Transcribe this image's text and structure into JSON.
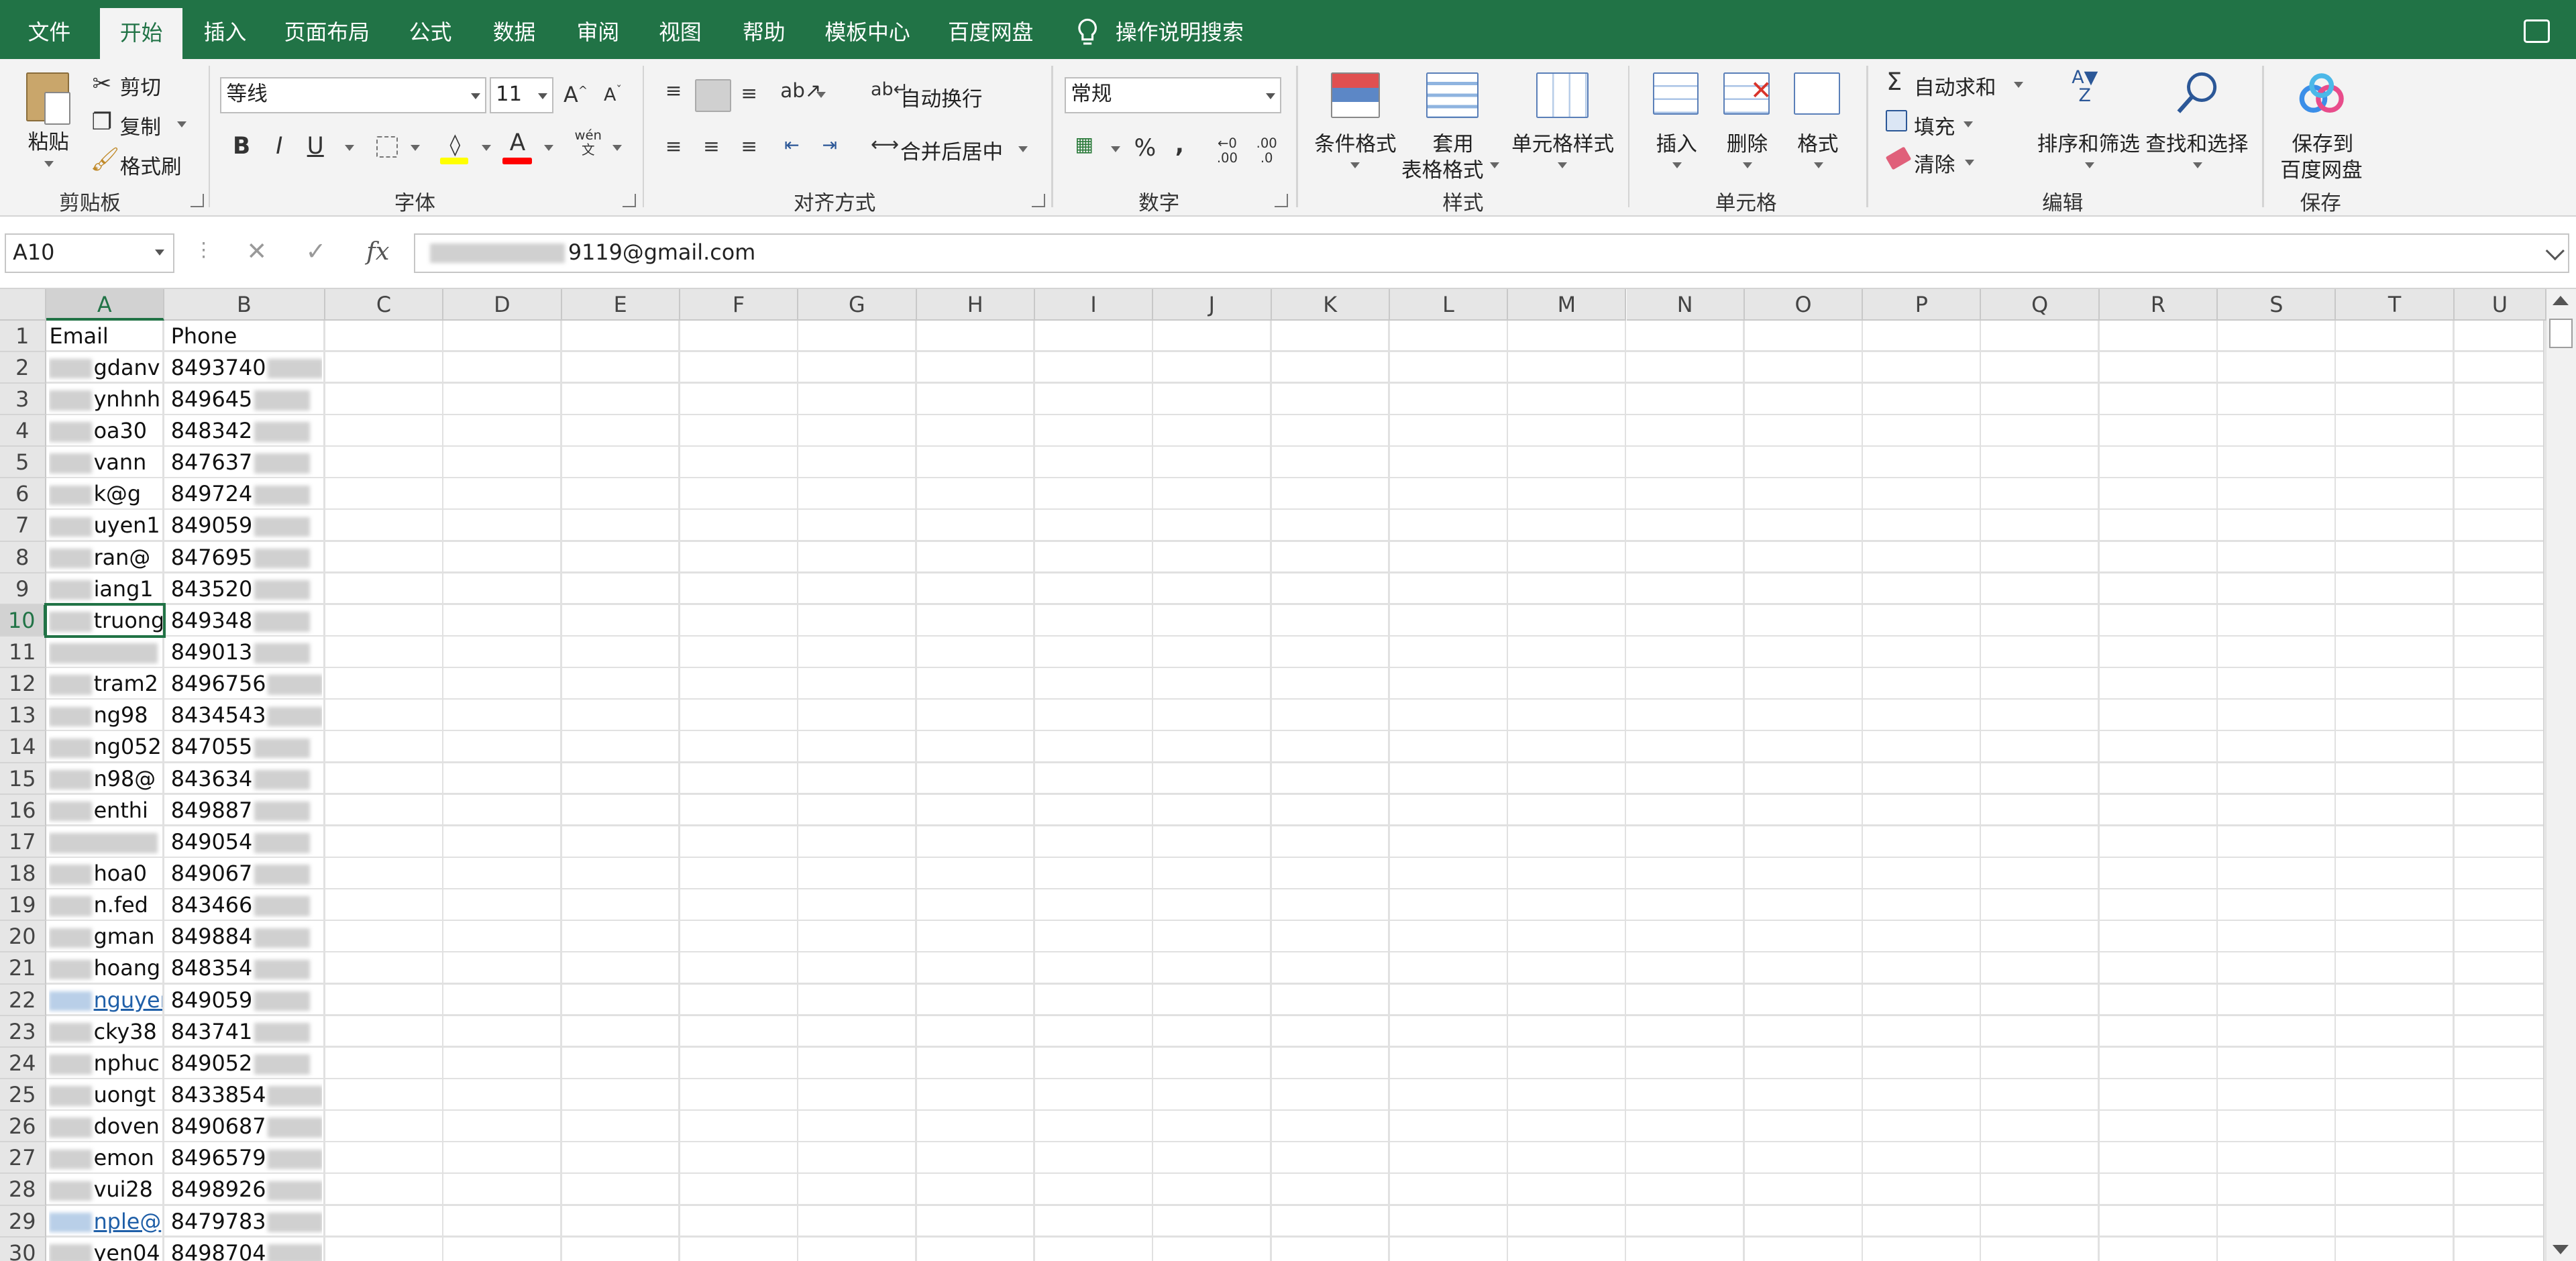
{
  "menu": {
    "tabs": [
      "文件",
      "开始",
      "插入",
      "页面布局",
      "公式",
      "数据",
      "审阅",
      "视图",
      "帮助",
      "模板中心",
      "百度网盘"
    ],
    "active_tab": "开始",
    "tell_me": "操作说明搜索"
  },
  "ribbon": {
    "clipboard": {
      "paste": "粘贴",
      "cut": "剪切",
      "copy": "复制",
      "format_painter": "格式刷",
      "group": "剪贴板"
    },
    "font": {
      "name": "等线",
      "size": "11",
      "bold": "B",
      "italic": "I",
      "underline": "U",
      "phonetic": "wén",
      "group": "字体"
    },
    "alignment": {
      "wrap": "自动换行",
      "merge": "合并后居中",
      "group": "对齐方式"
    },
    "number": {
      "format": "常规",
      "percent": "%",
      "comma": ",",
      "inc_decimal": ".00",
      "dec_decimal": ".0",
      "group": "数字"
    },
    "styles": {
      "conditional": "条件格式",
      "table_line1": "套用",
      "table_line2": "表格格式",
      "cell_styles": "单元格样式",
      "group": "样式"
    },
    "cells": {
      "insert": "插入",
      "delete": "删除",
      "format": "格式",
      "group": "单元格"
    },
    "editing": {
      "autosum": "自动求和",
      "fill": "填充",
      "clear": "清除",
      "sort": "排序和筛选",
      "find": "查找和选择",
      "group": "编辑"
    },
    "save": {
      "line1": "保存到",
      "line2": "百度网盘",
      "group": "保存"
    }
  },
  "formula_bar": {
    "name_box": "A10",
    "fx": "fx",
    "value_suffix": "9119@gmail.com"
  },
  "sheet": {
    "columns": [
      "A",
      "B",
      "C",
      "D",
      "E",
      "F",
      "G",
      "H",
      "I",
      "J",
      "K",
      "L",
      "M",
      "N",
      "O",
      "P",
      "Q",
      "R",
      "S",
      "T",
      "U"
    ],
    "selected_column": "A",
    "selected_row": 10,
    "rows": [
      "1",
      "2",
      "3",
      "4",
      "5",
      "6",
      "7",
      "8",
      "9",
      "10",
      "11",
      "12",
      "13",
      "14",
      "15",
      "16",
      "17",
      "18",
      "19",
      "20",
      "21",
      "22",
      "23",
      "24",
      "25",
      "26",
      "27",
      "28",
      "29",
      "30"
    ],
    "cells": [
      {
        "a": "Email",
        "b": "Phone"
      },
      {
        "a": "gdanv",
        "b": "8493740"
      },
      {
        "a": "ynhnh",
        "b": "849645"
      },
      {
        "a": "oa30",
        "b": "848342"
      },
      {
        "a": "vann",
        "b": "847637"
      },
      {
        "a": "k@g",
        "b": "849724"
      },
      {
        "a": "uyen1",
        "b": "849059"
      },
      {
        "a": "ran@",
        "b": "847695"
      },
      {
        "a": "iang1",
        "b": "843520"
      },
      {
        "a": "truong",
        "b": "849348"
      },
      {
        "a": "",
        "b": "849013"
      },
      {
        "a": "tram2",
        "b": "8496756"
      },
      {
        "a": "ng98",
        "b": "8434543"
      },
      {
        "a": "ng052",
        "b": "847055"
      },
      {
        "a": "n98@",
        "b": "843634"
      },
      {
        "a": "enthi",
        "b": "849887"
      },
      {
        "a": "",
        "b": "849054"
      },
      {
        "a": "hoa0",
        "b": "849067"
      },
      {
        "a": "n.fed",
        "b": "843466"
      },
      {
        "a": "gman",
        "b": "849884"
      },
      {
        "a": "hoang",
        "b": "848354"
      },
      {
        "a": "nguyen",
        "b": "849059"
      },
      {
        "a": "cky38",
        "b": "843741"
      },
      {
        "a": "nphuc",
        "b": "849052"
      },
      {
        "a": "uongt",
        "b": "8433854"
      },
      {
        "a": "doven",
        "b": "8490687"
      },
      {
        "a": "emon",
        "b": "8496579"
      },
      {
        "a": "vui28",
        "b": "8498926"
      },
      {
        "a": "nple@",
        "b": "8479783"
      },
      {
        "a": "yen04",
        "b": "8498704"
      }
    ]
  },
  "colors": {
    "excel_green": "#217346",
    "ribbon_bg": "#f3f3f3",
    "header_bg": "#e6e6e6",
    "link": "#1f5fa8"
  }
}
